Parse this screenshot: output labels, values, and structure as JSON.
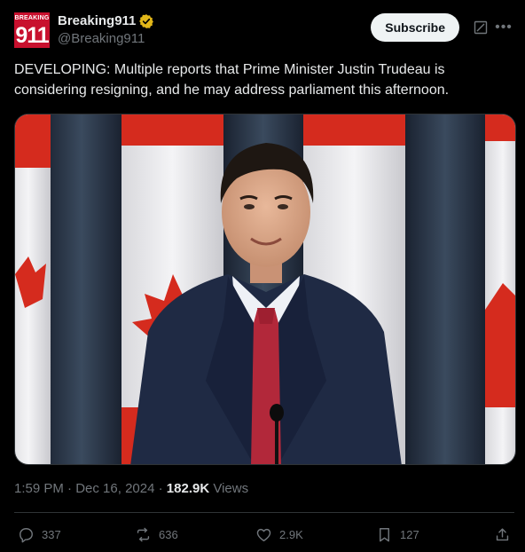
{
  "account": {
    "avatar_top": "BREAKING",
    "avatar_num": "911",
    "display_name": "Breaking911",
    "handle": "@Breaking911"
  },
  "header": {
    "subscribe_label": "Subscribe"
  },
  "tweet": {
    "text": "DEVELOPING: Multiple reports that Prime Minister Justin Trudeau is considering resigning, and he may address parliament this afternoon.",
    "time": "1:59 PM",
    "separator": "·",
    "date": "Dec 16, 2024",
    "views_count": "182.9K",
    "views_label": "Views"
  },
  "actions": {
    "replies": "337",
    "reposts": "636",
    "likes": "2.9K",
    "bookmarks": "127"
  },
  "colors": {
    "background": "#000000",
    "text": "#e7e9ea",
    "secondary": "#71767b",
    "verified_gold": "#e2b719",
    "brand_red": "#c8102e"
  },
  "icons": [
    "verified-gold-icon",
    "grok-icon",
    "more-icon",
    "reply-icon",
    "repost-icon",
    "like-icon",
    "bookmark-icon",
    "share-icon"
  ]
}
